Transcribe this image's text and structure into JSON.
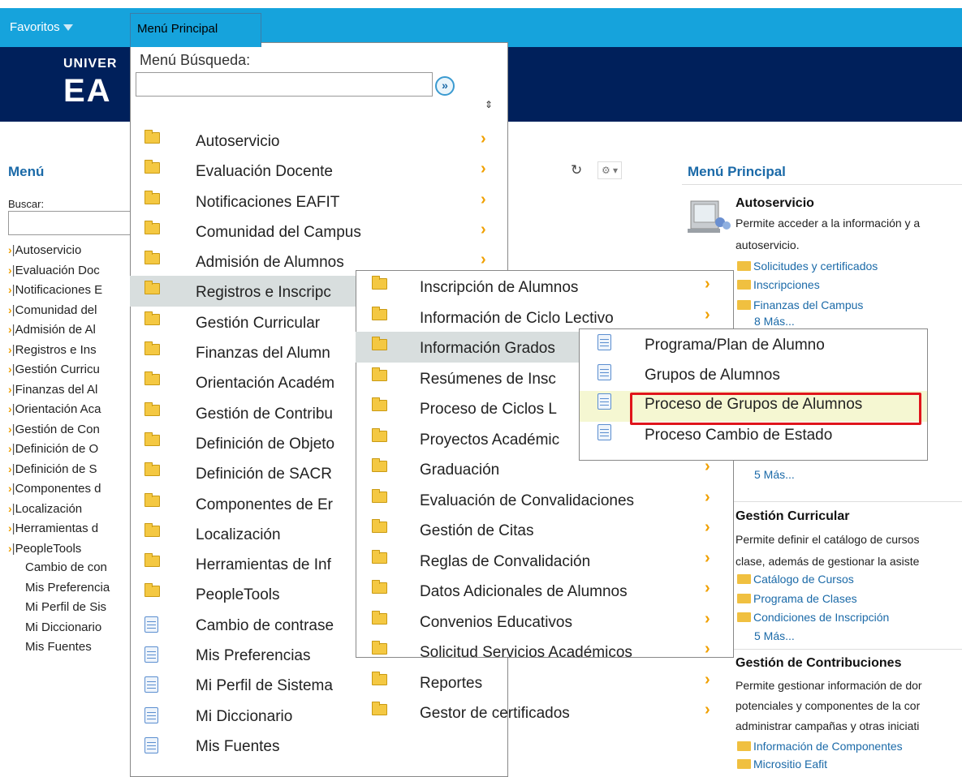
{
  "topbar": {
    "favorites": "Favoritos",
    "main_menu_tab": "Menú Principal"
  },
  "logo": {
    "line1": "UNIVER",
    "line2": "EA"
  },
  "left_menu": {
    "title": "Menú",
    "search_label": "Buscar:",
    "items": [
      {
        "label": "Autoservicio",
        "arrow": true
      },
      {
        "label": "Evaluación Doc",
        "arrow": true
      },
      {
        "label": "Notificaciones E",
        "arrow": true
      },
      {
        "label": "Comunidad del",
        "arrow": true
      },
      {
        "label": "Admisión de Al",
        "arrow": true
      },
      {
        "label": "Registros e Ins",
        "arrow": true
      },
      {
        "label": "Gestión Curricu",
        "arrow": true
      },
      {
        "label": "Finanzas del Al",
        "arrow": true
      },
      {
        "label": "Orientación Aca",
        "arrow": true
      },
      {
        "label": "Gestión de Con",
        "arrow": true
      },
      {
        "label": "Definición de O",
        "arrow": true
      },
      {
        "label": "Definición de S",
        "arrow": true
      },
      {
        "label": "Componentes d",
        "arrow": true
      },
      {
        "label": "Localización",
        "arrow": true
      },
      {
        "label": "Herramientas d",
        "arrow": true
      },
      {
        "label": "PeopleTools",
        "arrow": true
      },
      {
        "label": "Cambio de con",
        "arrow": false
      },
      {
        "label": "Mis Preferencia",
        "arrow": false
      },
      {
        "label": "Mi Perfil de Sis",
        "arrow": false
      },
      {
        "label": "Mi Diccionario",
        "arrow": false
      },
      {
        "label": "Mis Fuentes",
        "arrow": false
      }
    ]
  },
  "main_dropdown": {
    "search_label": "Menú Búsqueda:",
    "search_value": "",
    "go_button": "»",
    "sort_icon": "⇕",
    "items": [
      {
        "label": "Autoservicio",
        "icon": "folder",
        "chevron": true
      },
      {
        "label": "Evaluación Docente",
        "icon": "folder",
        "chevron": true
      },
      {
        "label": "Notificaciones EAFIT",
        "icon": "folder",
        "chevron": true
      },
      {
        "label": "Comunidad del Campus",
        "icon": "folder",
        "chevron": true
      },
      {
        "label": "Admisión de Alumnos",
        "icon": "folder",
        "chevron": true
      },
      {
        "label": "Registros e Inscripc",
        "icon": "folder",
        "chevron": false,
        "highlight": true
      },
      {
        "label": "Gestión Curricular",
        "icon": "folder",
        "chevron": false
      },
      {
        "label": "Finanzas del Alumn",
        "icon": "folder",
        "chevron": false
      },
      {
        "label": "Orientación Académ",
        "icon": "folder",
        "chevron": false
      },
      {
        "label": "Gestión de Contribu",
        "icon": "folder",
        "chevron": false
      },
      {
        "label": "Definición de Objeto",
        "icon": "folder",
        "chevron": false
      },
      {
        "label": "Definición de SACR",
        "icon": "folder",
        "chevron": false
      },
      {
        "label": "Componentes de Er",
        "icon": "folder",
        "chevron": false
      },
      {
        "label": "Localización",
        "icon": "folder",
        "chevron": false
      },
      {
        "label": "Herramientas de Inf",
        "icon": "folder",
        "chevron": false
      },
      {
        "label": "PeopleTools",
        "icon": "folder",
        "chevron": false
      },
      {
        "label": "Cambio de contrase",
        "icon": "doc",
        "chevron": false
      },
      {
        "label": "Mis Preferencias",
        "icon": "doc",
        "chevron": false
      },
      {
        "label": "Mi Perfil de Sistema",
        "icon": "doc",
        "chevron": false
      },
      {
        "label": "Mi Diccionario",
        "icon": "doc",
        "chevron": false
      },
      {
        "label": "Mis Fuentes",
        "icon": "doc",
        "chevron": false
      }
    ]
  },
  "submenu_registros": {
    "items": [
      {
        "label": "Inscripción de Alumnos",
        "chevron": true
      },
      {
        "label": "Información de Ciclo Lectivo",
        "chevron": true
      },
      {
        "label": "Información Grados",
        "chevron": false,
        "highlight": true
      },
      {
        "label": "Resúmenes de Insc",
        "chevron": false
      },
      {
        "label": "Proceso de Ciclos L",
        "chevron": false
      },
      {
        "label": "Proyectos Académic",
        "chevron": false
      },
      {
        "label": "Graduación",
        "chevron": true
      },
      {
        "label": "Evaluación de Convalidaciones",
        "chevron": true
      },
      {
        "label": "Gestión de Citas",
        "chevron": true
      },
      {
        "label": "Reglas de Convalidación",
        "chevron": true
      },
      {
        "label": "Datos Adicionales de Alumnos",
        "chevron": true
      },
      {
        "label": "Convenios Educativos",
        "chevron": true
      },
      {
        "label": "Solicitud Servicios Académicos",
        "chevron": true
      },
      {
        "label": "Reportes",
        "chevron": true
      },
      {
        "label": "Gestor de certificados",
        "chevron": true
      }
    ]
  },
  "submenu_grados": {
    "items": [
      {
        "label": "Programa/Plan de Alumno"
      },
      {
        "label": "Grupos de Alumnos"
      },
      {
        "label": "Proceso de Grupos de Alumnos",
        "highlight": true
      },
      {
        "label": "Proceso Cambio de Estado"
      }
    ]
  },
  "right_panel": {
    "title": "Menú Principal",
    "sections": {
      "autoservicio": {
        "title": "Autoservicio",
        "desc1": "Permite acceder a la información y a",
        "desc2": "autoservicio.",
        "links": [
          "Solicitudes y certificados",
          "Inscripciones",
          "Finanzas del Campus"
        ],
        "more": "8 Más..."
      },
      "registros_more": "5 Más...",
      "gestion_curricular": {
        "title": "Gestión Curricular",
        "desc1": "Permite definir el catálogo de cursos",
        "desc2": "clase, además de gestionar la asiste",
        "links": [
          "Catálogo de Cursos",
          "Programa de Clases",
          "Condiciones de Inscripción"
        ],
        "more": "5 Más..."
      },
      "gestion_contribuciones": {
        "title": "Gestión de Contribuciones",
        "desc1": "Permite gestionar información de dor",
        "desc2": "potenciales y componentes de la cor",
        "desc3": "administrar campañas y otras iniciati",
        "links": [
          "Información de Componentes",
          "Micrositio Eafit"
        ]
      }
    }
  },
  "colors": {
    "topbar": "#16a3dc",
    "banner": "#00205b",
    "link": "#1b6aa8",
    "chevron": "#f0a000",
    "highlight_box": "#e0151b"
  }
}
